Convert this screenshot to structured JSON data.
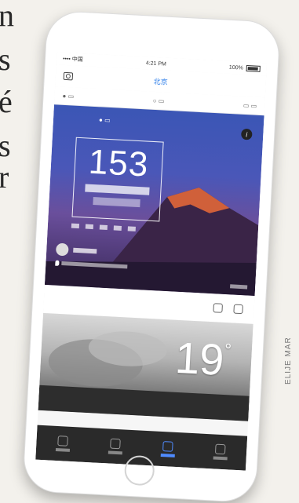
{
  "page_text": {
    "letters": [
      "n",
      "s",
      "é",
      "s",
      "r"
    ]
  },
  "credit": "ELIJE MAR",
  "phone": {
    "status_bar": {
      "carrier": "•••• 中国",
      "time": "4:21 PM",
      "battery": "100%"
    },
    "header": {
      "city": "北京"
    },
    "aqi": {
      "value": "153"
    },
    "weather": {
      "temperature": "19",
      "degree": "°"
    }
  },
  "colors": {
    "accent": "#2b7de9",
    "sky": "#4a57b8",
    "tabbar": "#2a2a2a"
  }
}
